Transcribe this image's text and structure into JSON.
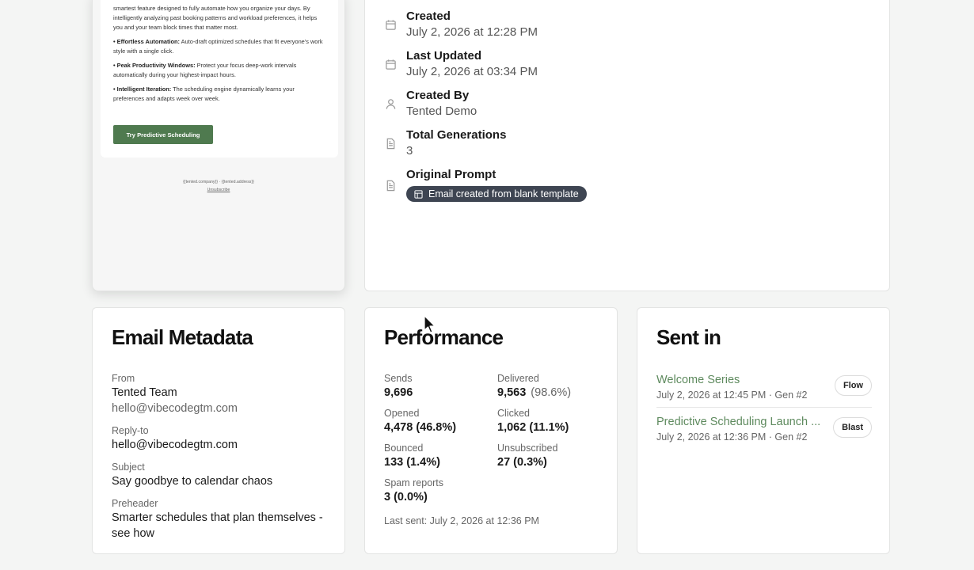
{
  "preview": {
    "intro": "smartest feature designed to fully automate how you organize your days. By intelligently analyzing past booking patterns and workload preferences, it helps you and your team block times that matter most.",
    "bullets": [
      {
        "title": "• Effortless Automation:",
        "text": " Auto-draft optimized schedules that fit everyone's work style with a single click."
      },
      {
        "title": "• Peak Productivity Windows:",
        "text": " Protect your focus deep-work intervals automatically during your highest-impact hours."
      },
      {
        "title": "• Intelligent Iteration:",
        "text": " The scheduling engine dynamically learns your preferences and adapts week over week."
      }
    ],
    "cta_label": "Try Predictive Scheduling",
    "footer_address": "{{tented.company}} · {{tented.address}}",
    "footer_unsubscribe": "Unsubscribe"
  },
  "details": {
    "created_label": "Created",
    "created_value": "July 2, 2026 at 12:28 PM",
    "updated_label": "Last Updated",
    "updated_value": "July 2, 2026 at 03:34 PM",
    "created_by_label": "Created By",
    "created_by_value": "Tented Demo",
    "generations_label": "Total Generations",
    "generations_value": "3",
    "prompt_label": "Original Prompt",
    "prompt_value": "Email created from blank template"
  },
  "metadata": {
    "title": "Email Metadata",
    "from_label": "From",
    "from_name": "Tented Team",
    "from_email": "hello@vibecodegtm.com",
    "reply_label": "Reply-to",
    "reply_value": "hello@vibecodegtm.com",
    "subject_label": "Subject",
    "subject_value": "Say goodbye to calendar chaos",
    "preheader_label": "Preheader",
    "preheader_value": "Smarter schedules that plan themselves - see how"
  },
  "performance": {
    "title": "Performance",
    "sends_label": "Sends",
    "sends_value": "9,696",
    "delivered_label": "Delivered",
    "delivered_value": "9,563",
    "delivered_pct": "(98.6%)",
    "opened_label": "Opened",
    "opened_value": "4,478 (46.8%)",
    "clicked_label": "Clicked",
    "clicked_value": "1,062 (11.1%)",
    "bounced_label": "Bounced",
    "bounced_value": "133 (1.4%)",
    "unsub_label": "Unsubscribed",
    "unsub_value": "27 (0.3%)",
    "spam_label": "Spam reports",
    "spam_value": "3 (0.0%)",
    "last_sent": "Last sent: July 2, 2026 at 12:36 PM"
  },
  "sent_in": {
    "title": "Sent in",
    "items": [
      {
        "name": "Welcome Series",
        "meta": "July 2, 2026 at 12:45 PM · Gen #2",
        "badge": "Flow"
      },
      {
        "name": "Predictive Scheduling Launch ...",
        "meta": "July 2, 2026 at 12:36 PM · Gen #2",
        "badge": "Blast"
      }
    ]
  },
  "colors": {
    "accent_green": "#4f7a4f",
    "link_green": "#5e8a5e",
    "pill_bg": "#3e4552"
  },
  "icons": [
    "calendar-icon",
    "calendar-icon",
    "user-icon",
    "document-icon",
    "document-icon",
    "template-icon",
    "cursor-icon"
  ]
}
